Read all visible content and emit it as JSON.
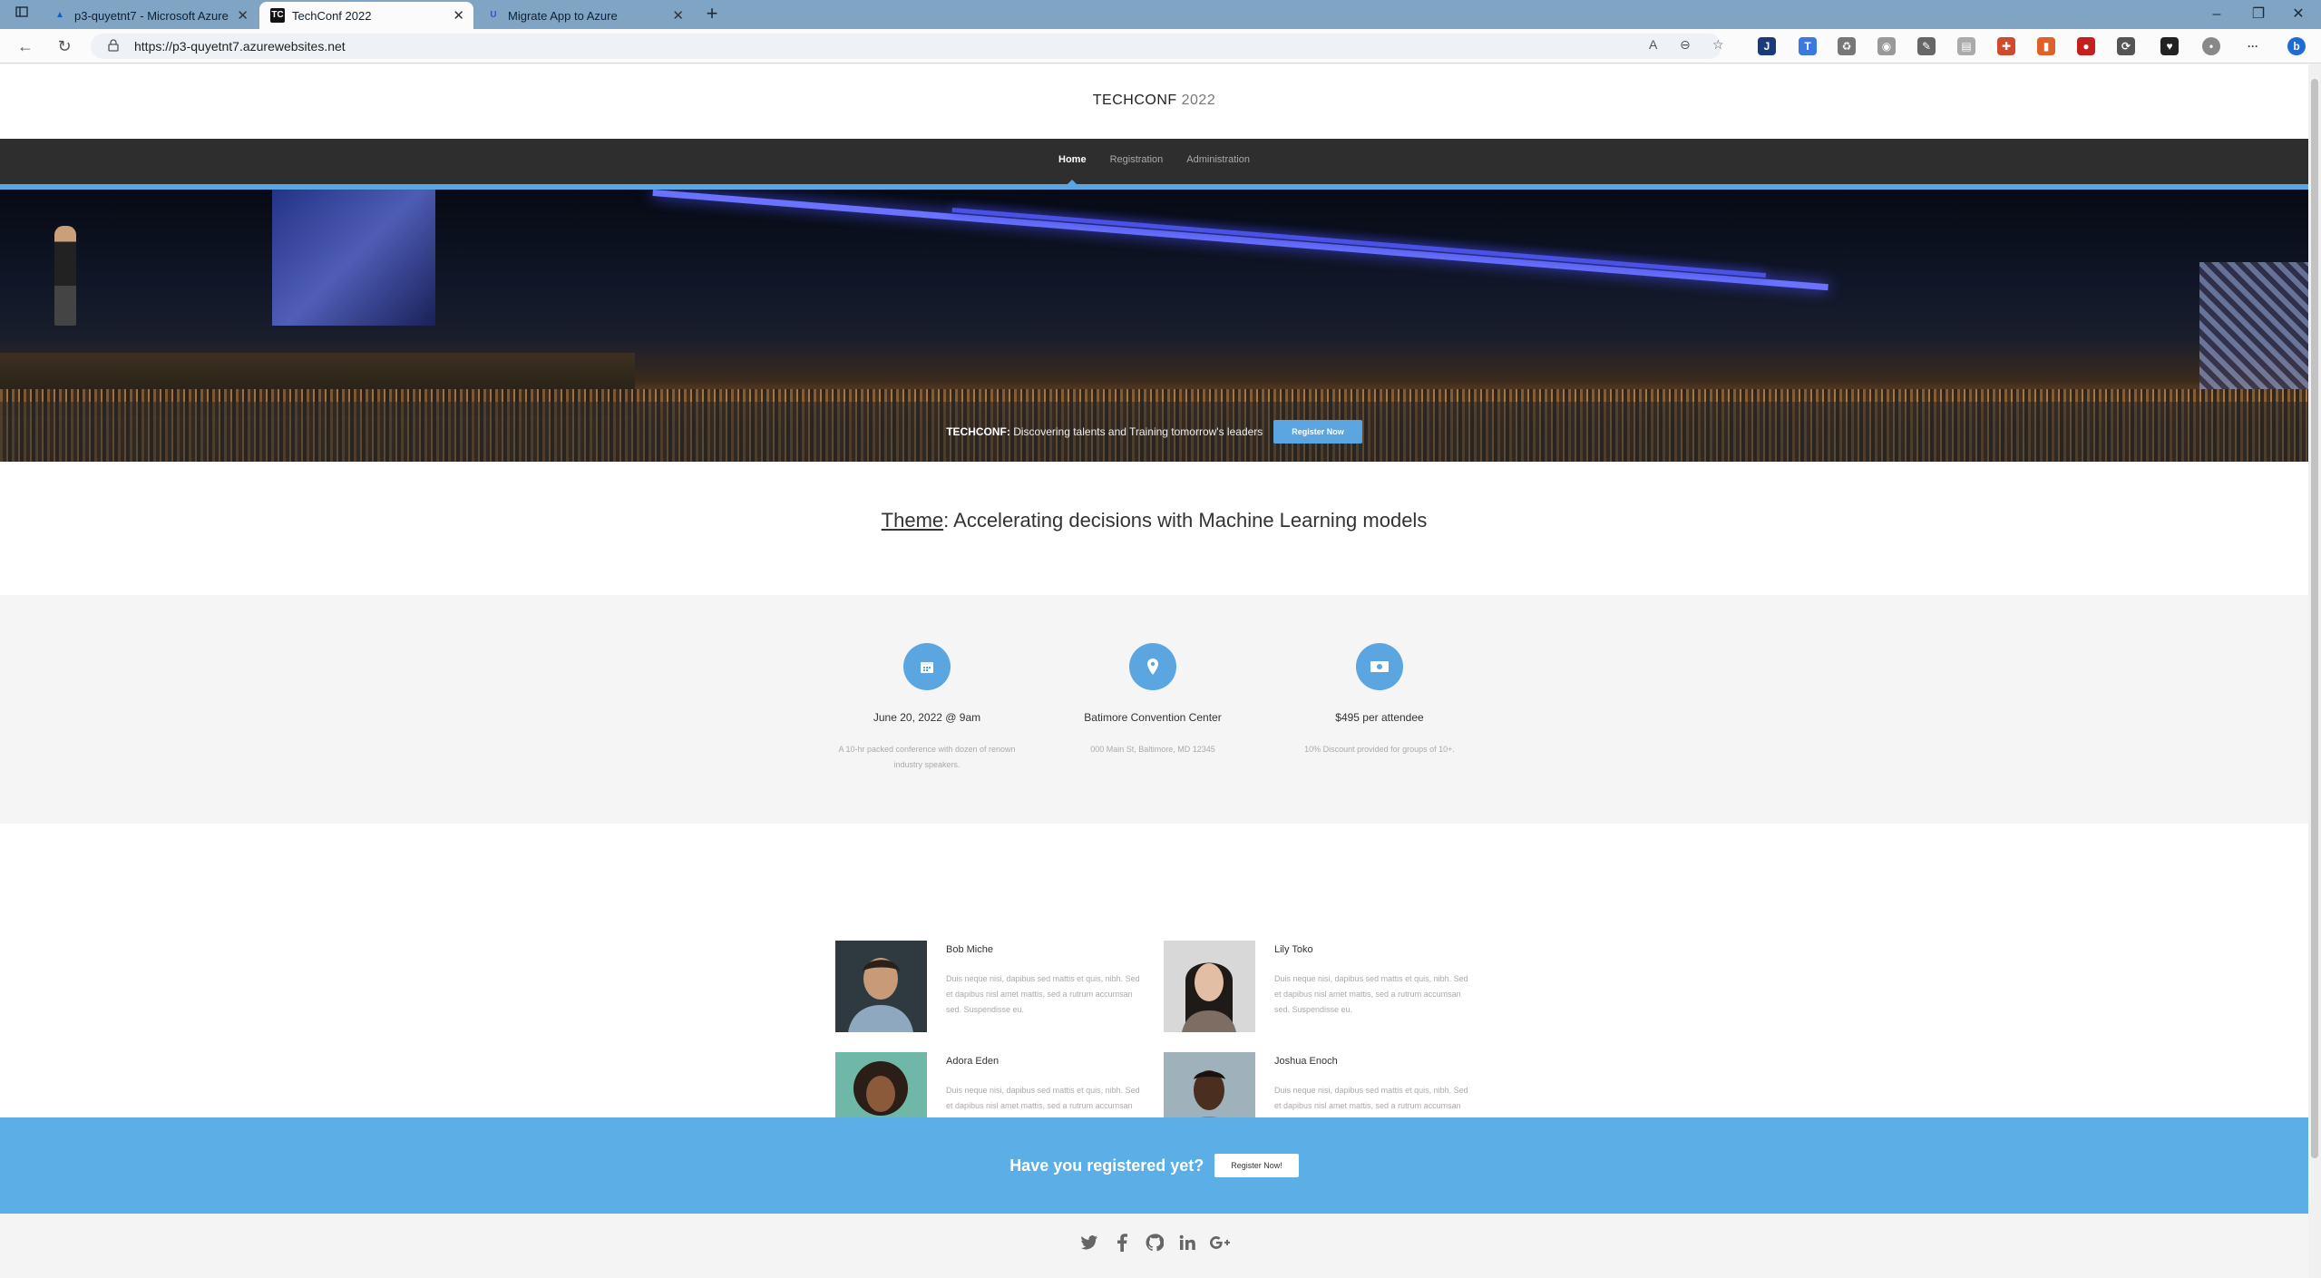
{
  "browser": {
    "tabs": [
      {
        "title": "p3-quyetnt7 - Microsoft Azure"
      },
      {
        "title": "TechConf 2022",
        "favicon_text": "TC"
      },
      {
        "title": "Migrate App to Azure"
      }
    ],
    "url": "https://p3-quyetnt7.azurewebsites.net"
  },
  "site": {
    "brand": "TECHCONF",
    "year": "2022",
    "nav": [
      "Home",
      "Registration",
      "Administration"
    ],
    "active_nav": "Home"
  },
  "hero": {
    "tag_bold": "TECHCONF:",
    "tag_text": "Discovering talents and Training tomorrow's leaders",
    "button": "Register Now"
  },
  "theme": {
    "label": "Theme",
    "text": ": Accelerating decisions with Machine Learning models"
  },
  "features": [
    {
      "icon": "calendar-icon",
      "title": "June 20, 2022 @ 9am",
      "desc": "A 10-hr packed conference with dozen of renown industry speakers."
    },
    {
      "icon": "map-pin-icon",
      "title": "Batimore Convention Center",
      "desc": "000 Main St, Baltimore, MD 12345"
    },
    {
      "icon": "money-icon",
      "title": "$495 per attendee",
      "desc": "10% Discount provided for groups of 10+."
    }
  ],
  "speakers": [
    {
      "name": "Bob Miche",
      "bio": "Duis neque nisi, dapibus sed mattis et quis, nibh. Sed et dapibus nisl amet mattis, sed a rutrum accumsan sed. Suspendisse eu."
    },
    {
      "name": "Lily Toko",
      "bio": "Duis neque nisi, dapibus sed mattis et quis, nibh. Sed et dapibus nisl amet mattis, sed a rutrum accumsan sed. Suspendisse eu."
    },
    {
      "name": "Adora Eden",
      "bio": "Duis neque nisi, dapibus sed mattis et quis, nibh. Sed et dapibus nisl amet mattis, sed a rutrum accumsan sed. Suspendisse eu."
    },
    {
      "name": "Joshua Enoch",
      "bio": "Duis neque nisi, dapibus sed mattis et quis, nibh. Sed et dapibus nisl amet mattis, sed a rutrum accumsan sed. Suspendisse eu."
    }
  ],
  "cta": {
    "text": "Have you registered yet?",
    "button": "Register Now!"
  },
  "footer": {
    "social": [
      "twitter-icon",
      "facebook-icon",
      "github-icon",
      "linkedin-icon",
      "google-plus-icon"
    ]
  },
  "colors": {
    "accent": "#5ba6e0",
    "nav_bg": "#2e2e2e",
    "cta_bg": "#5baee6"
  }
}
